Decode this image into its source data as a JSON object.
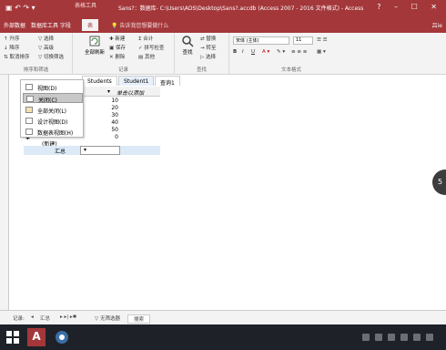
{
  "window": {
    "context_tab": "表格工具",
    "title": "Sans?：数据库- C:\\Users\\ADS\\Desktop\\Sans?.accdb (Access 2007 - 2016 文件格式) - Access",
    "controls": "?  –  ☐  ✕"
  },
  "tabs": [
    {
      "label": "外部数据"
    },
    {
      "label": "数据库工具"
    },
    {
      "label": "字段"
    },
    {
      "label": "表"
    }
  ],
  "tell_me": "告诉我您想要做什么",
  "user": "吕ie",
  "ribbon": {
    "groups": [
      {
        "label": "排序和筛选"
      },
      {
        "label": "记录"
      },
      {
        "label": "查找"
      },
      {
        "label": "文本格式"
      }
    ],
    "sort_filter": {
      "ascending": "升序",
      "descending": "降序",
      "remove_sort": "取消排序",
      "selection": "选择",
      "advanced": "高级",
      "toggle_filter": "切换筛选"
    },
    "records": {
      "refresh_all": "全部刷新",
      "new": "新建",
      "save": "保存",
      "delete": "删除",
      "totals": "合计",
      "spelling": "拼写检查",
      "more": "其他"
    },
    "find": {
      "find": "查找",
      "replace": "替换",
      "goto": "转至",
      "select": "选择"
    },
    "text_format": {
      "font": "宋体 (主体)",
      "size": "11"
    }
  },
  "doc_tabs": [
    {
      "label": "Students"
    },
    {
      "label": "Student1"
    },
    {
      "label": "查询1"
    }
  ],
  "grid": {
    "add_field": "单击以添加",
    "values": [
      "10",
      "20",
      "30",
      "40",
      "50",
      "0"
    ],
    "new_record": "(新建)",
    "total_label": "汇总"
  },
  "context_menu": {
    "items": [
      {
        "label": "视图(D)",
        "highlighted": false
      },
      {
        "label": "关闭(C)",
        "highlighted": true
      },
      {
        "label": "全部关闭(L)",
        "highlighted": false
      },
      {
        "label": "设计视图(D)",
        "highlighted": false
      },
      {
        "label": "数据表视图(H)",
        "highlighted": false
      }
    ]
  },
  "status": {
    "record_label": "记录:",
    "record_value": "汇总",
    "filter": "无筛选器",
    "search": "搜索"
  },
  "overlay_bubble": "5"
}
